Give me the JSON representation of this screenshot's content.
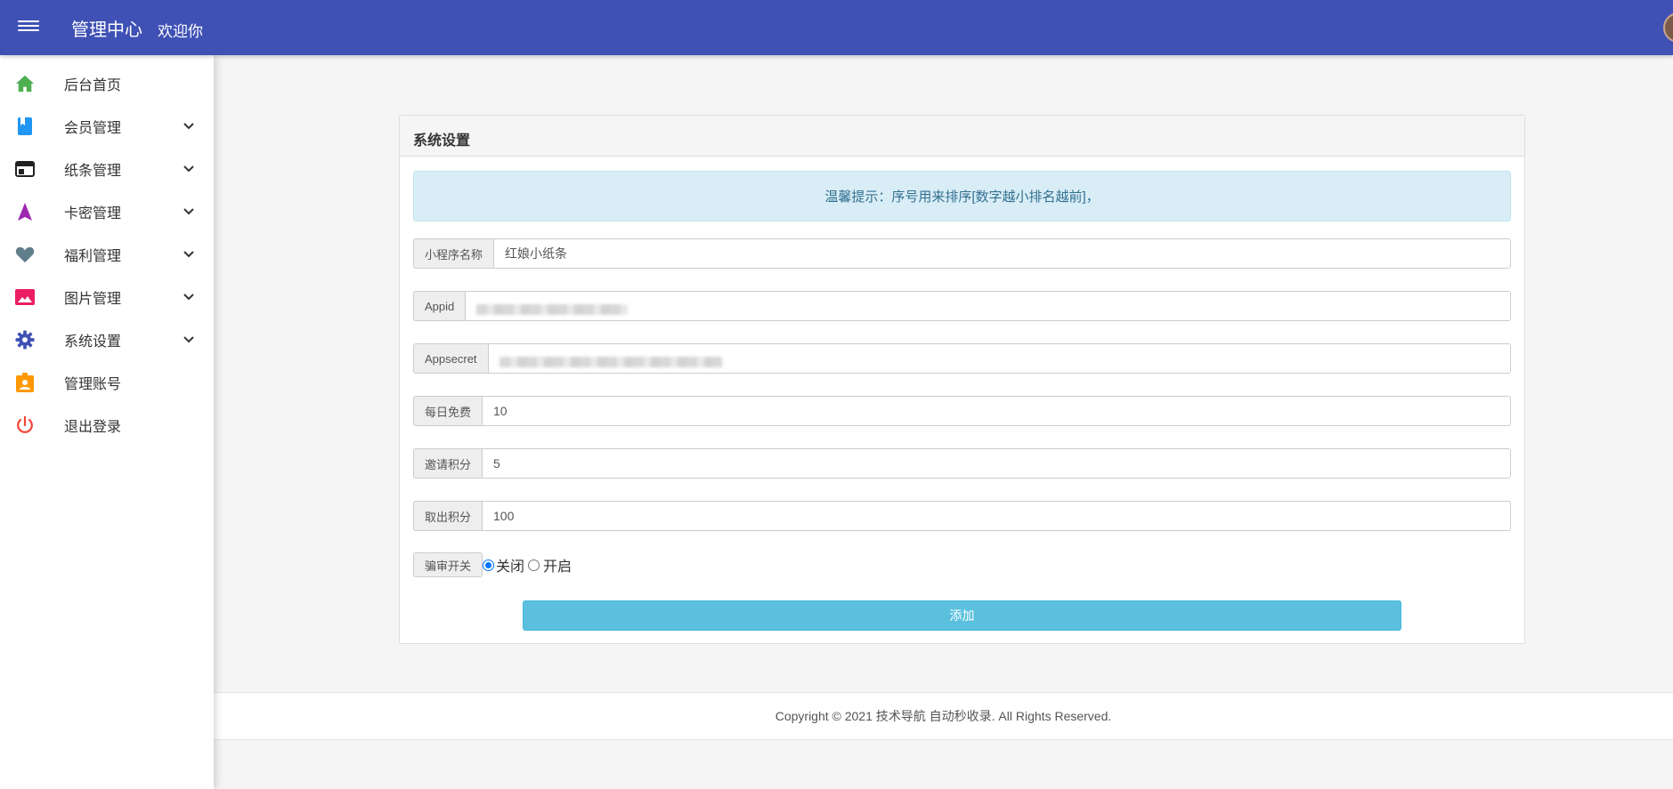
{
  "header": {
    "title": "管理中心",
    "welcome": "欢迎你"
  },
  "sidebar": {
    "items": [
      {
        "label": "后台首页",
        "icon": "home-icon",
        "color": "#4caf50",
        "expandable": false
      },
      {
        "label": "会员管理",
        "icon": "book-icon",
        "color": "#2196f3",
        "expandable": true
      },
      {
        "label": "纸条管理",
        "icon": "web-icon",
        "color": "#212121",
        "expandable": true
      },
      {
        "label": "卡密管理",
        "icon": "navigation-icon",
        "color": "#9c27b0",
        "expandable": true
      },
      {
        "label": "福利管理",
        "icon": "heart-icon",
        "color": "#607d8b",
        "expandable": true
      },
      {
        "label": "图片管理",
        "icon": "image-icon",
        "color": "#e91e63",
        "expandable": true
      },
      {
        "label": "系统设置",
        "icon": "gear-icon",
        "color": "#3f51b5",
        "expandable": true
      },
      {
        "label": "管理账号",
        "icon": "badge-icon",
        "color": "#ff9800",
        "expandable": false
      },
      {
        "label": "退出登录",
        "icon": "power-icon",
        "color": "#f44336",
        "expandable": false
      }
    ]
  },
  "panel": {
    "title": "系统设置",
    "notice": "温馨提示：序号用来排序[数字越小排名越前]，",
    "fields": [
      {
        "label": "小程序名称",
        "value": "红娘小纸条",
        "redacted": false
      },
      {
        "label": "Appid",
        "value": "",
        "redacted": true
      },
      {
        "label": "Appsecret",
        "value": "",
        "redacted": true
      },
      {
        "label": "每日免费",
        "value": "10",
        "redacted": false
      },
      {
        "label": "邀请积分",
        "value": "5",
        "redacted": false
      },
      {
        "label": "取出积分",
        "value": "100",
        "redacted": false
      }
    ],
    "review_switch": {
      "label": "骗审开关",
      "options": [
        {
          "label": "关闭",
          "checked": true
        },
        {
          "label": "开启",
          "checked": false
        }
      ]
    },
    "submit_label": "添加"
  },
  "footer": {
    "text": "Copyright © 2021 技术导航 自动秒收录. All Rights Reserved."
  },
  "colors": {
    "header_bg": "#3f51b5",
    "button_bg": "#5bc0de",
    "alert_bg": "#d9edf7",
    "alert_text": "#31708f"
  }
}
